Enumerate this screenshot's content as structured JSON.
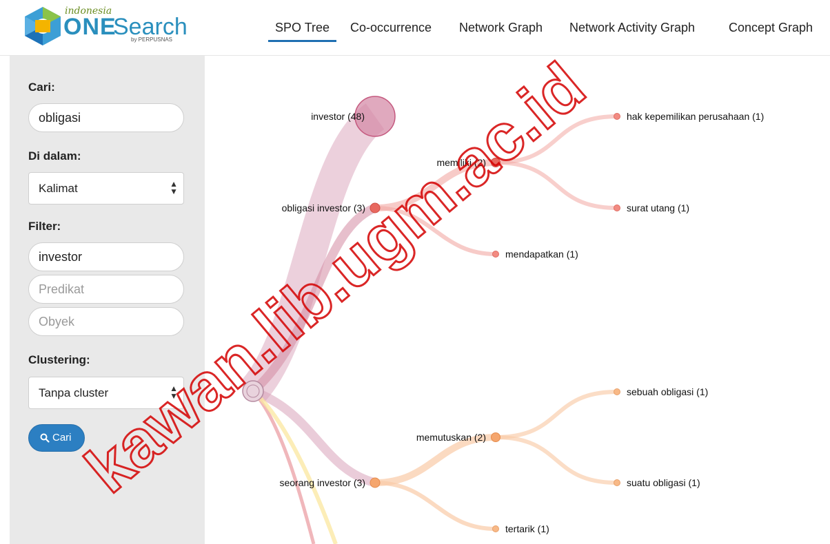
{
  "logo": {
    "small": "indonesia",
    "one": "ONE",
    "search": "Search",
    "by": "by PERPUSNAS"
  },
  "nav": {
    "items": [
      {
        "label": "SPO Tree",
        "active": true
      },
      {
        "label": "Co-occurrence",
        "active": false
      },
      {
        "label": "Network Graph",
        "active": false
      },
      {
        "label": "Network Activity Graph",
        "active": false
      },
      {
        "label": "Concept Graph",
        "active": false
      }
    ]
  },
  "sidebar": {
    "search_label": "Cari:",
    "search_value": "obligasi",
    "within_label": "Di dalam:",
    "within_value": "Kalimat",
    "filter_label": "Filter:",
    "filter_subject_value": "investor",
    "filter_predicate_placeholder": "Predikat",
    "filter_object_placeholder": "Obyek",
    "clustering_label": "Clustering:",
    "clustering_value": "Tanpa cluster",
    "search_button": "Cari"
  },
  "tree": {
    "root": {
      "label": "investor (48)"
    },
    "branches": [
      {
        "label": "obligasi investor (3)",
        "color": "#e8685f",
        "children": [
          {
            "label": "memiliki (2)",
            "children": [
              {
                "label": "hak kepemilikan perusahaan (1)"
              },
              {
                "label": "surat utang (1)"
              }
            ]
          },
          {
            "label": "mendapatkan (1)",
            "children": []
          }
        ]
      },
      {
        "label": "seorang investor (3)",
        "color": "#f5a66e",
        "children": [
          {
            "label": "memutuskan (2)",
            "children": [
              {
                "label": "sebuah obligasi (1)"
              },
              {
                "label": "suatu obligasi (1)"
              }
            ]
          },
          {
            "label": "tertarik (1)",
            "children": []
          }
        ]
      }
    ]
  },
  "watermark": {
    "text": "kawan.lib.ugm.ac.id",
    "color": "#d40000"
  },
  "colors": {
    "accent": "#1f6fb2",
    "button": "#2c7fc2",
    "root": "#d9a2b9",
    "branch_red": "#e8685f",
    "branch_orange": "#f5a66e"
  }
}
